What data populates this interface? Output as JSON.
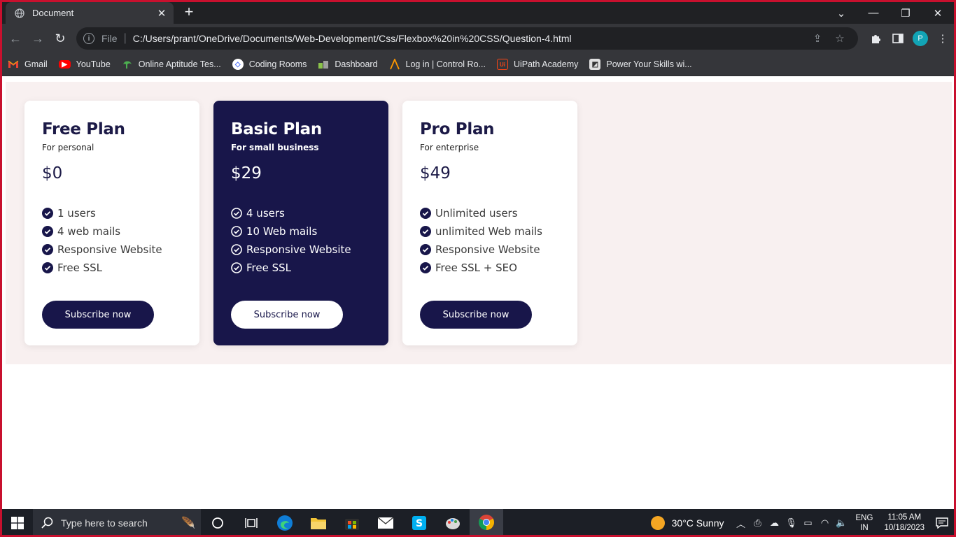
{
  "browser": {
    "tab_title": "Document",
    "scheme_label": "File",
    "url": "C:/Users/prant/OneDrive/Documents/Web-Development/Css/Flexbox%20in%20CSS/Question-4.html",
    "profile_initial": "P"
  },
  "bookmarks": [
    {
      "label": "Gmail",
      "icon": "gmail-icon",
      "color": "#ea4335"
    },
    {
      "label": "YouTube",
      "icon": "youtube-icon",
      "color": "#ff0000"
    },
    {
      "label": "Online Aptitude Tes...",
      "icon": "aptitude-icon",
      "color": "#2e7d32"
    },
    {
      "label": "Coding Rooms",
      "icon": "coding-rooms-icon",
      "color": "#4a6cf7"
    },
    {
      "label": "Dashboard",
      "icon": "dashboard-icon",
      "color": "#5f6368"
    },
    {
      "label": "Log in | Control Ro...",
      "icon": "control-room-icon",
      "color": "#ff9800"
    },
    {
      "label": "UiPath Academy",
      "icon": "uipath-icon",
      "color": "#fa4616"
    },
    {
      "label": "Power Your Skills wi...",
      "icon": "power-skills-icon",
      "color": "#444"
    }
  ],
  "plans": [
    {
      "name": "Free Plan",
      "subtitle": "For personal",
      "price": "$0",
      "features": [
        "1 users",
        "4 web mails",
        "Responsive Website",
        "Free SSL"
      ],
      "button": "Subscribe now"
    },
    {
      "name": "Basic Plan",
      "subtitle": "For small business",
      "price": "$29",
      "features": [
        "4 users",
        "10 Web mails",
        "Responsive Website",
        "Free SSL"
      ],
      "button": "Subscribe now"
    },
    {
      "name": "Pro Plan",
      "subtitle": "For enterprise",
      "price": "$49",
      "features": [
        "Unlimited users",
        "unlimited Web mails",
        "Responsive Website",
        "Free SSL + SEO"
      ],
      "button": "Subscribe now"
    }
  ],
  "colors": {
    "accent_navy": "#18164a",
    "container_bg": "#f8f0f0",
    "window_border": "#c8102e"
  },
  "taskbar": {
    "search_placeholder": "Type here to search",
    "weather": "30°C  Sunny",
    "lang_top": "ENG",
    "lang_bottom": "IN",
    "time": "11:05 AM",
    "date": "10/18/2023"
  }
}
